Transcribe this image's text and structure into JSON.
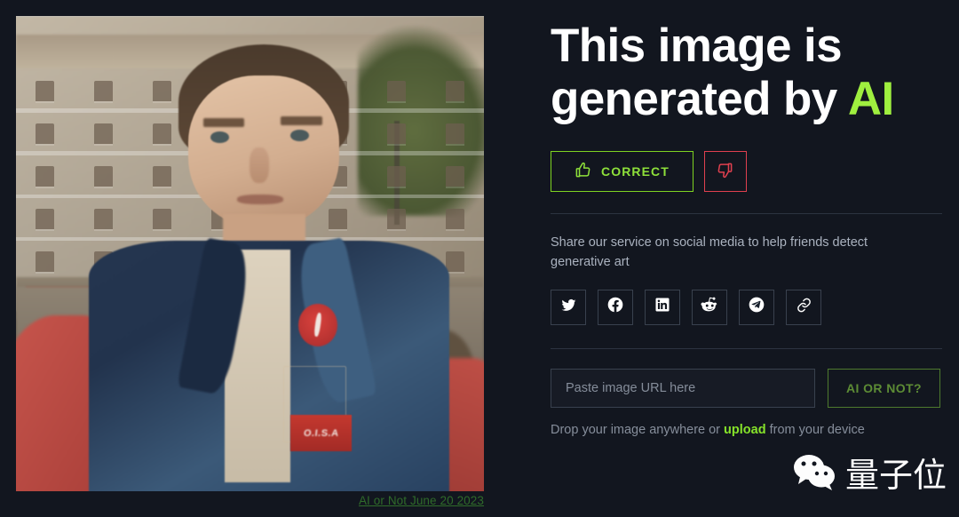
{
  "photo": {
    "caption": "AI or Not June 20 2023",
    "alt_description": "Vintage-style color photograph of a young man in a denim jacket standing in a crowd in front of a classical stone building",
    "badge_text": "O.I.S.A"
  },
  "headline": {
    "line1": "This image is",
    "line2_prefix": "generated by ",
    "line2_accent": "AI"
  },
  "verdict": {
    "correct_label": "CORRECT",
    "correct_icon": "thumbs-up-icon",
    "wrong_icon": "thumbs-down-icon",
    "correct_color": "#7ed321",
    "wrong_color": "#e0404f"
  },
  "share": {
    "text": "Share our service on social media to help friends detect generative art",
    "items": [
      {
        "name": "twitter-icon",
        "label": "Twitter"
      },
      {
        "name": "facebook-icon",
        "label": "Facebook"
      },
      {
        "name": "linkedin-icon",
        "label": "LinkedIn"
      },
      {
        "name": "reddit-icon",
        "label": "Reddit"
      },
      {
        "name": "telegram-icon",
        "label": "Telegram"
      },
      {
        "name": "link-icon",
        "label": "Copy link"
      }
    ]
  },
  "upload": {
    "url_placeholder": "Paste image URL here",
    "url_value": "",
    "submit_label": "AI OR NOT?",
    "drop_prefix": "Drop your image anywhere or ",
    "drop_link": "upload",
    "drop_suffix": " from your device"
  },
  "watermark": {
    "logo": "wechat-icon",
    "text": "量子位"
  },
  "colors": {
    "background": "#12161f",
    "accent_green": "#9fef3f",
    "muted_green": "#4e7a2e",
    "red": "#e0404f",
    "divider": "#2c3340"
  }
}
